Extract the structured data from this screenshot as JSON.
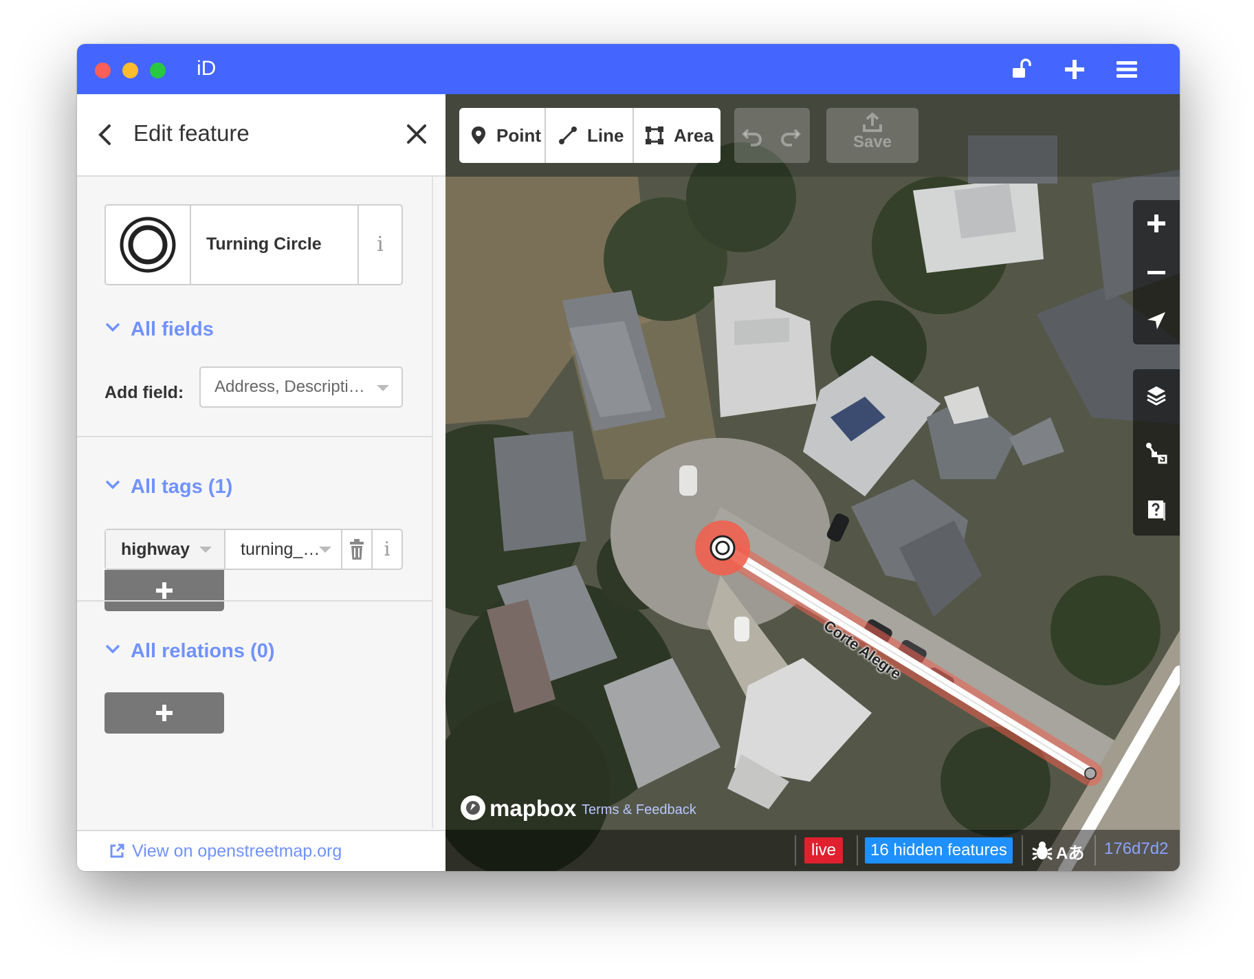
{
  "titlebar": {
    "app_title": "iD",
    "icons": [
      "lock-open-icon",
      "plus-icon",
      "menu-icon"
    ]
  },
  "sidebar": {
    "header_title": "Edit feature",
    "preset": {
      "name": "Turning Circle",
      "icon": "turning-circle-icon",
      "info_label": "i"
    },
    "fields_section": {
      "label": "All fields",
      "add_field_label": "Add field:",
      "add_field_placeholder": "Address, Descripti…"
    },
    "tags_section": {
      "label": "All tags (1)",
      "tags": [
        {
          "key": "highway",
          "value": "turning_…"
        }
      ],
      "info_label": "i"
    },
    "relations_section": {
      "label": "All relations (0)"
    },
    "footer_link": "View on openstreetmap.org"
  },
  "map": {
    "modes": {
      "point": "Point",
      "line": "Line",
      "area": "Area"
    },
    "save_label": "Save",
    "road_label": "Corte Alegre",
    "attribution": {
      "logo": "mapbox",
      "terms": "Terms & Feedback"
    },
    "status": {
      "live": "live",
      "hidden_features": "16 hidden features",
      "language_label": "Aあ",
      "version": "176d7d2"
    },
    "colors": {
      "accent": "#4466ff",
      "link": "#7092ff",
      "selected_halo": "#f0604f",
      "live": "#e0202e",
      "hidden": "#1e90ff"
    }
  }
}
